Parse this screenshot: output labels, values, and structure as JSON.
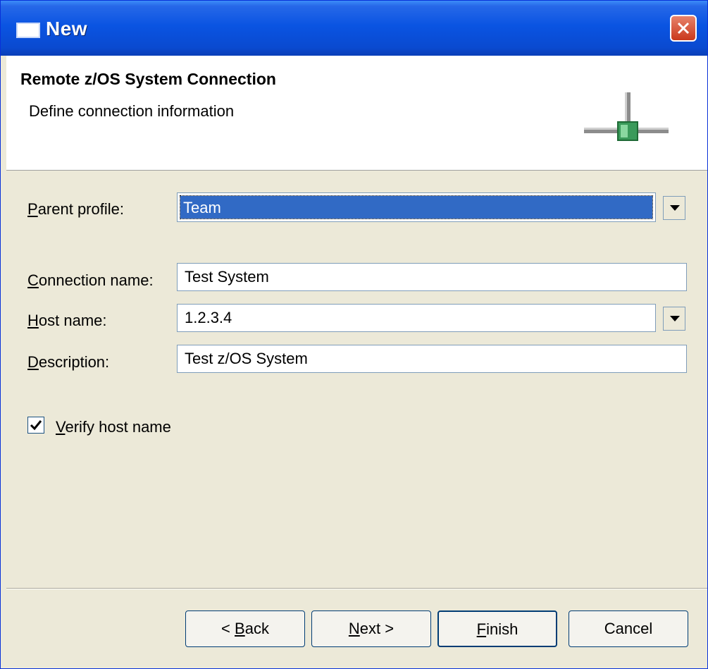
{
  "window": {
    "title": "New"
  },
  "header": {
    "title": "Remote z/OS System Connection",
    "subtitle": "Define connection information"
  },
  "form": {
    "parent_profile": {
      "label_access": "P",
      "label_rest": "arent profile:",
      "value": "Team"
    },
    "connection_name": {
      "label_access": "C",
      "label_rest": "onnection name:",
      "value": "Test System"
    },
    "host_name": {
      "label_access": "H",
      "label_rest": "ost name:",
      "value": "1.2.3.4"
    },
    "description": {
      "label_access": "D",
      "label_rest": "escription:",
      "value": "Test z/OS System"
    },
    "verify_host": {
      "label_access": "V",
      "label_rest": "erify host name",
      "checked": true
    }
  },
  "buttons": {
    "back": {
      "prefix": "< ",
      "access": "B",
      "rest": "ack"
    },
    "next": {
      "access": "N",
      "rest": "ext >"
    },
    "finish": {
      "access": "F",
      "rest": "inish"
    },
    "cancel": {
      "label": "Cancel"
    }
  },
  "icons": {
    "window_icon": "window-icon",
    "close_icon": "close-icon",
    "wizard_icon": "network-connection-icon",
    "dropdown_icon": "chevron-down-icon",
    "check_icon": "checkmark-icon"
  },
  "colors": {
    "titlebar": "#0a54e2",
    "selection": "#316ac5",
    "close_button": "#c9381c",
    "dialog_background": "#ece9d8"
  }
}
